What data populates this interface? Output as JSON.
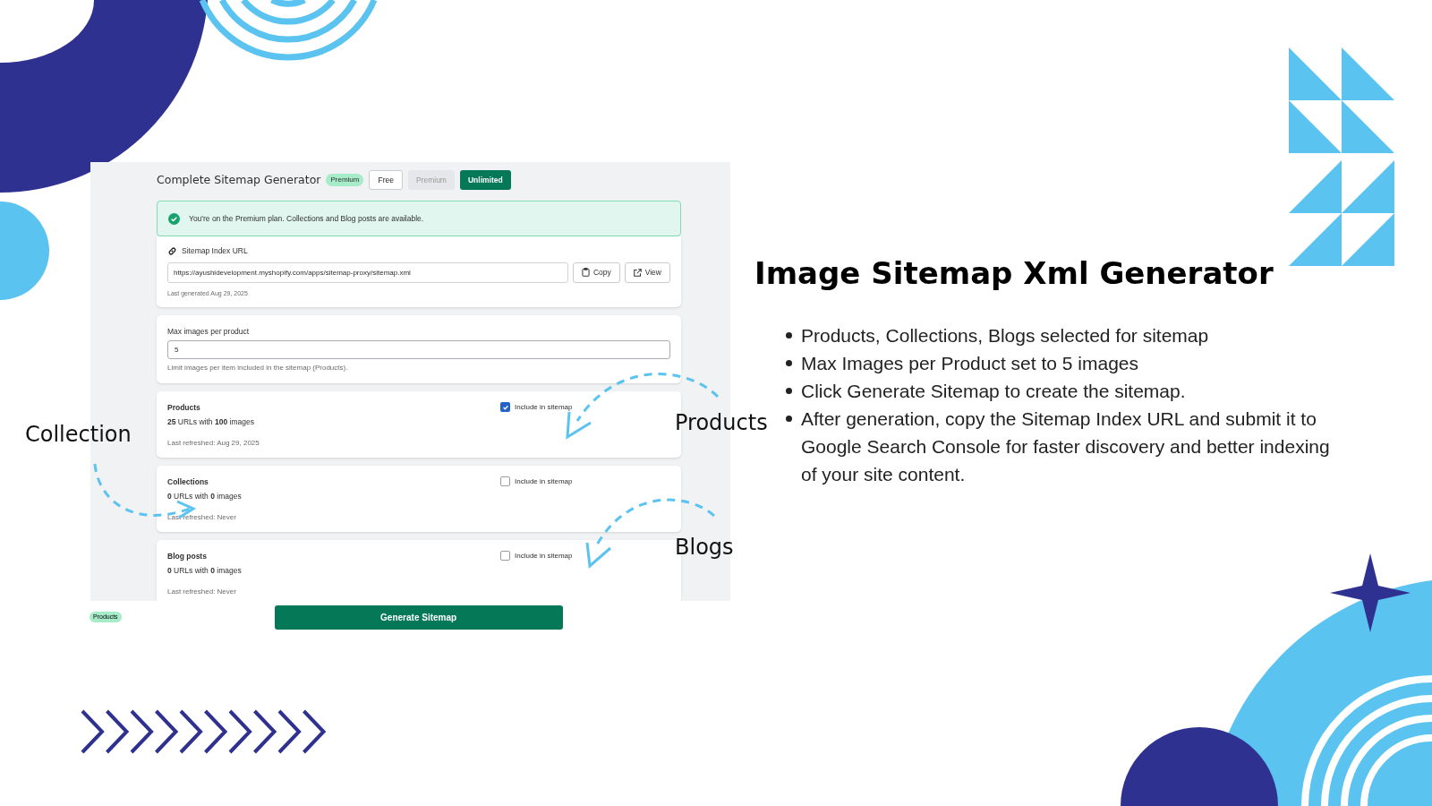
{
  "app": {
    "title": "Complete Sitemap Generator",
    "plan_badge": "Premium",
    "plan_buttons": [
      {
        "label": "Free",
        "selected": false,
        "disabled": false
      },
      {
        "label": "Premium",
        "selected": false,
        "disabled": true
      },
      {
        "label": "Unlimited",
        "selected": true,
        "disabled": false
      }
    ],
    "alert": "You're on the Premium plan. Collections and Blog posts are available.",
    "sitemap_url": {
      "label": "Sitemap Index URL",
      "value": "https://ayushidevelopment.myshopify.com/apps/sitemap-proxy/sitemap.xml",
      "buttons": [
        "Copy",
        "View"
      ],
      "note": "Last generated Aug 29, 2025"
    },
    "max_images": {
      "label": "Max images per product",
      "value": "5",
      "help": "Limit images per item included in the sitemap (Products)."
    },
    "sections": [
      {
        "title": "Products",
        "summary": "**25** URLs with **100** images",
        "refreshed": "Last refreshed: Aug 29, 2025",
        "checkbox": "Include in sitemap",
        "checked": true
      },
      {
        "title": "Collections",
        "summary": "**0** URLs with **0** images",
        "refreshed": "Last refreshed: Never",
        "checkbox": "Include in sitemap",
        "checked": false
      },
      {
        "title": "Blog posts",
        "summary": "**0** URLs with **0** images",
        "refreshed": "Last refreshed: Never",
        "checkbox": "Include in sitemap",
        "checked": false
      }
    ],
    "footer_tag": "Products",
    "generate_button": "Generate Sitemap"
  },
  "annotations": [
    "Collection",
    "Products",
    "Blogs"
  ],
  "heading": "Image Sitemap Xml Generator",
  "bullets": [
    "Products, Collections, Blogs selected for sitemap",
    "Max Images per Product set to 5 images",
    "Click Generate Sitemap to create the sitemap.",
    "After generation, copy the Sitemap Index URL and submit it to Google Search Console for faster discovery and better indexing of your site content."
  ]
}
